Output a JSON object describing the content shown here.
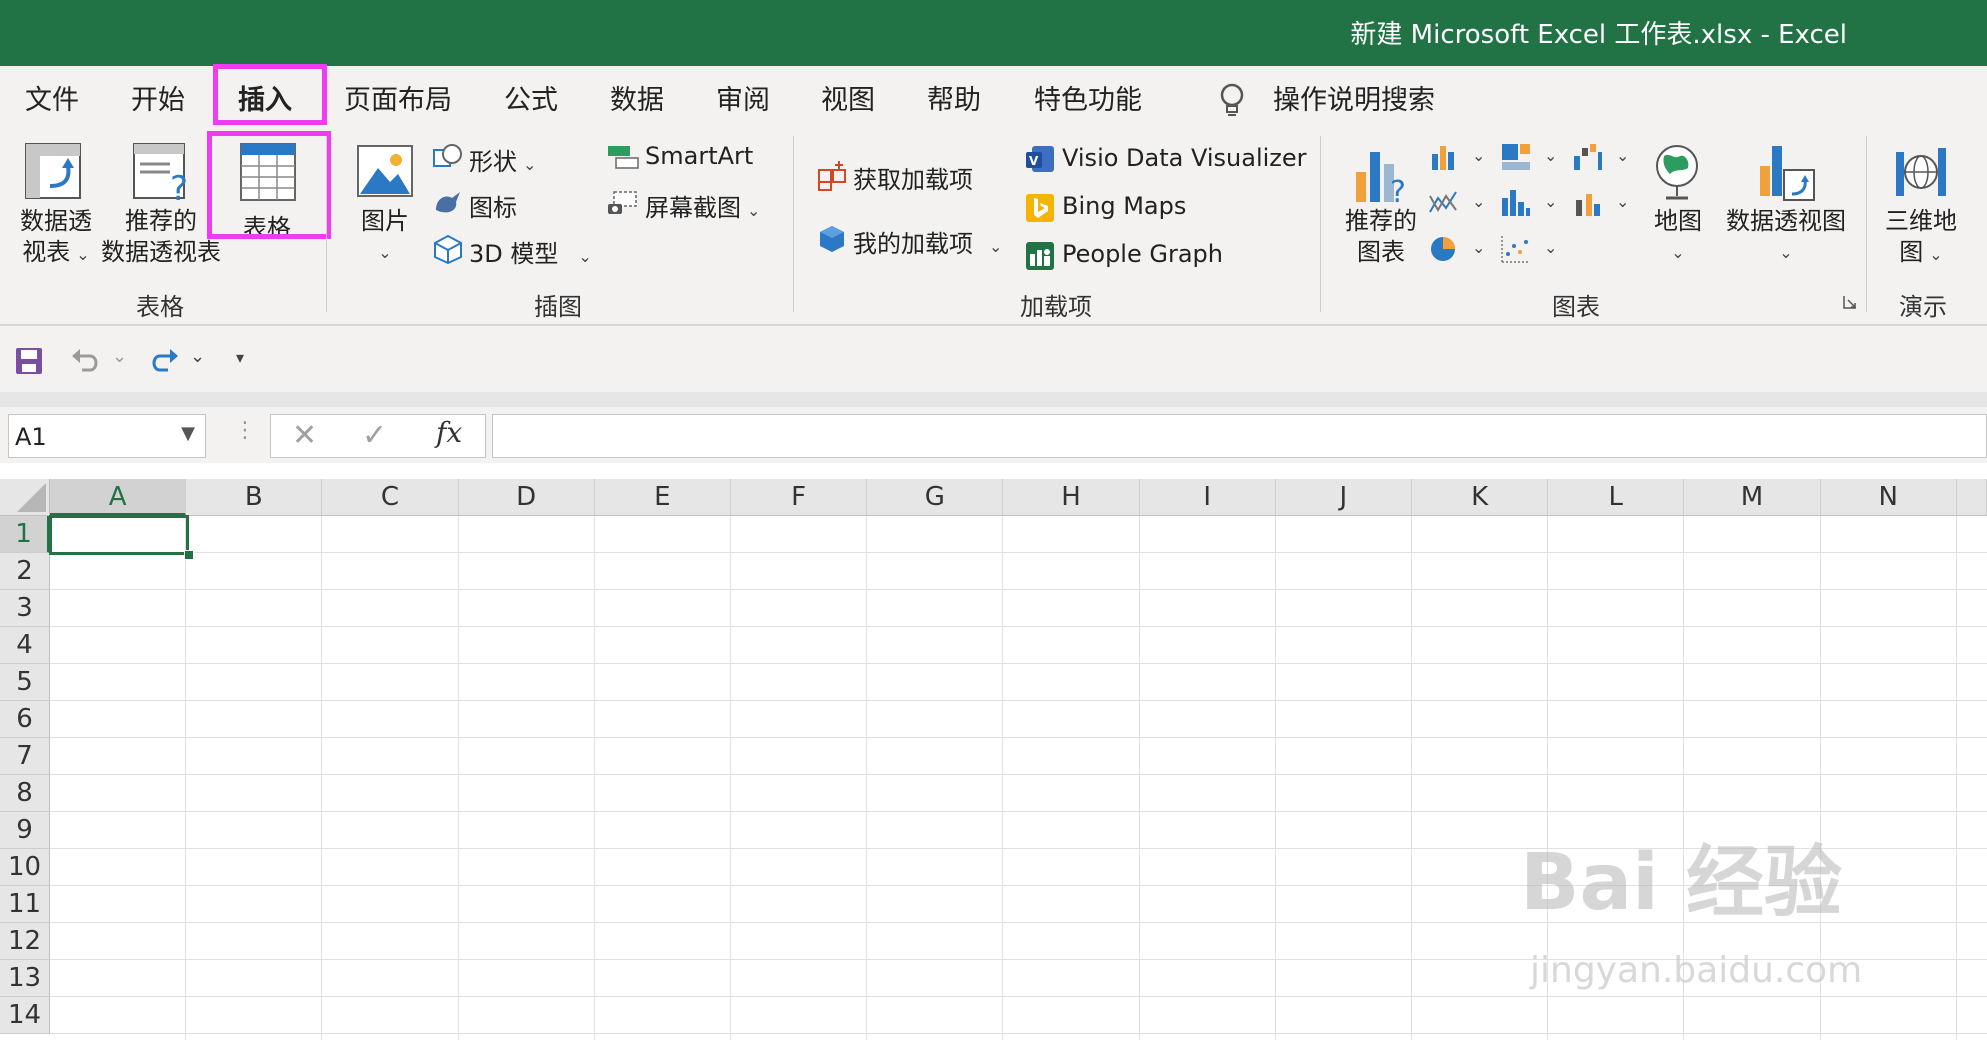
{
  "window": {
    "title": "新建 Microsoft Excel 工作表.xlsx  -  Excel"
  },
  "tabs": [
    {
      "label": "文件"
    },
    {
      "label": "开始"
    },
    {
      "label": "插入",
      "active": true
    },
    {
      "label": "页面布局"
    },
    {
      "label": "公式"
    },
    {
      "label": "数据"
    },
    {
      "label": "审阅"
    },
    {
      "label": "视图"
    },
    {
      "label": "帮助"
    },
    {
      "label": "特色功能"
    }
  ],
  "tell_me": "操作说明搜索",
  "ribbon": {
    "tables": {
      "group": "表格",
      "pivot_line1": "数据透",
      "pivot_line2": "视表",
      "rec_pivot_line1": "推荐的",
      "rec_pivot_line2": "数据透视表",
      "table": "表格"
    },
    "illustrations": {
      "group": "插图",
      "pictures": "图片",
      "shapes": "形状",
      "icons": "图标",
      "models": "3D 模型",
      "smartart": "SmartArt",
      "screenshot": "屏幕截图"
    },
    "addins": {
      "group": "加载项",
      "get": "获取加载项",
      "my": "我的加载项",
      "visio": "Visio Data Visualizer",
      "bing": "Bing Maps",
      "people": "People Graph"
    },
    "charts": {
      "group": "图表",
      "rec_line1": "推荐的",
      "rec_line2": "图表",
      "maps": "地图",
      "pivot_chart": "数据透视图"
    },
    "tours": {
      "group": "演示",
      "map3d_line1": "三维地",
      "map3d_line2": "图"
    }
  },
  "formula_bar": {
    "name_box": "A1",
    "fx": "fx",
    "formula": ""
  },
  "sheet": {
    "columns": [
      "A",
      "B",
      "C",
      "D",
      "E",
      "F",
      "G",
      "H",
      "I",
      "J",
      "K",
      "L",
      "M",
      "N"
    ],
    "rows": [
      "1",
      "2",
      "3",
      "4",
      "5",
      "6",
      "7",
      "8",
      "9",
      "10",
      "11",
      "12",
      "13",
      "14"
    ],
    "active_cell": "A1"
  },
  "watermark": {
    "brand": "Bai 经验",
    "url": "jingyan.baidu.com"
  },
  "colors": {
    "excel_green": "#217346",
    "highlight": "#f03cf0"
  }
}
